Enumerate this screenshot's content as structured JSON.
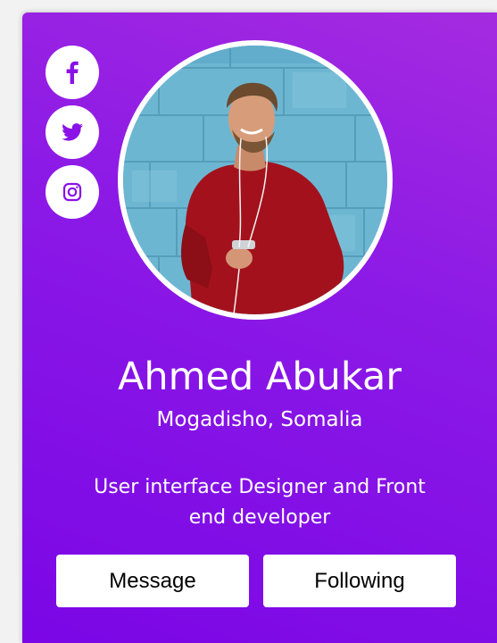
{
  "profile": {
    "name": "Ahmed Abukar",
    "location": "Mogadisho, Somalia",
    "bio": "User interface Designer and Front end developer"
  },
  "social": [
    {
      "icon": "facebook-icon"
    },
    {
      "icon": "twitter-icon"
    },
    {
      "icon": "instagram-icon"
    }
  ],
  "buttons": {
    "message_label": "Message",
    "following_label": "Following"
  },
  "colors": {
    "accent": "#8a12e6",
    "card_gradient_start": "#a52be0",
    "card_gradient_end": "#7b06e6"
  }
}
